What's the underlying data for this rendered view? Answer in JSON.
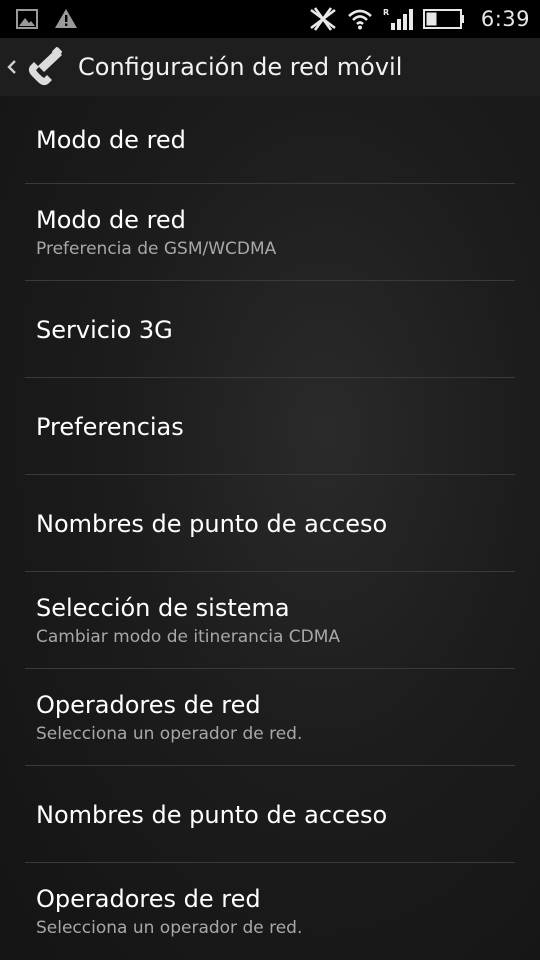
{
  "status_bar": {
    "time": "6:39",
    "roaming_indicator": "R",
    "icons_left": [
      "gallery-notification-icon",
      "warning-icon"
    ],
    "icons_right": [
      "no-data-icon",
      "wifi-icon",
      "signal-icon",
      "battery-icon"
    ]
  },
  "action_bar": {
    "title": "Configuración de red móvil",
    "app_icon": "phone-handset-icon"
  },
  "list": {
    "items": [
      {
        "title": "Modo de red",
        "summary": ""
      },
      {
        "title": "Modo de red",
        "summary": "Preferencia de GSM/WCDMA"
      },
      {
        "title": "Servicio 3G",
        "summary": ""
      },
      {
        "title": "Preferencias",
        "summary": ""
      },
      {
        "title": "Nombres de punto de acceso",
        "summary": ""
      },
      {
        "title": "Selección de sistema",
        "summary": "Cambiar modo de itinerancia CDMA"
      },
      {
        "title": "Operadores de red",
        "summary": "Selecciona un operador de red."
      },
      {
        "title": "Nombres de punto de acceso",
        "summary": ""
      },
      {
        "title": "Operadores de red",
        "summary": "Selecciona un operador de red."
      }
    ]
  },
  "colors": {
    "background": "#161616",
    "status_bar": "#000000",
    "action_bar": "#1e1e1e",
    "divider": "#3a3a3a",
    "summary_text": "#a8a8a8"
  }
}
